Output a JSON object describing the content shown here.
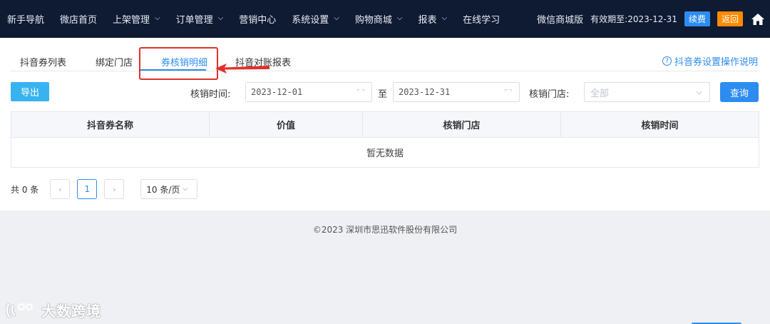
{
  "topnav": {
    "items": [
      {
        "label": "新手导航",
        "has_dropdown": false
      },
      {
        "label": "微店首页",
        "has_dropdown": false
      },
      {
        "label": "上架管理",
        "has_dropdown": true
      },
      {
        "label": "订单管理",
        "has_dropdown": true
      },
      {
        "label": "营销中心",
        "has_dropdown": false
      },
      {
        "label": "系统设置",
        "has_dropdown": true
      },
      {
        "label": "购物商城",
        "has_dropdown": true
      },
      {
        "label": "报表",
        "has_dropdown": true
      },
      {
        "label": "在线学习",
        "has_dropdown": false
      }
    ],
    "edition": "微信商城版",
    "expire": "有效期至:2023-12-31",
    "renew_label": "续费",
    "back_label": "返回",
    "home_icon": "home-icon"
  },
  "tabs": [
    {
      "label": "抖音券列表",
      "active": false
    },
    {
      "label": "绑定门店",
      "active": false
    },
    {
      "label": "券核销明细",
      "active": true
    },
    {
      "label": "抖音对账报表",
      "active": false
    }
  ],
  "help_link": "抖音券设置操作说明",
  "filters": {
    "export_label": "导出",
    "time_label": "核销时间:",
    "start_date": "2023-12-01",
    "to_label": "至",
    "end_date": "2023-12-31",
    "store_label": "核销门店:",
    "store_value": "全部",
    "query_label": "查询"
  },
  "table": {
    "columns": [
      "抖音券名称",
      "价值",
      "核销门店",
      "核销时间"
    ],
    "rows": [],
    "empty_text": "暂无数据"
  },
  "pagination": {
    "total_text": "共 0 条",
    "current_page": "1",
    "page_size": "10 条/页"
  },
  "footer": "©2023 深圳市思迅软件股份有限公司",
  "watermark": "大数跨境",
  "colors": {
    "nav_bg": "#0f1a33",
    "accent": "#2d8cf0",
    "export": "#39b3f0",
    "back": "#ff8a00",
    "annotation": "#e0312c"
  }
}
